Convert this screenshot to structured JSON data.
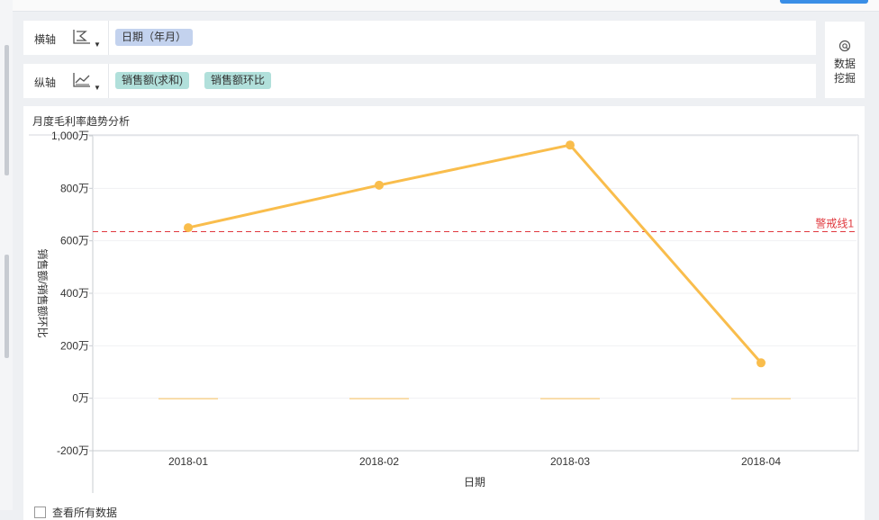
{
  "toolbar": {
    "x_axis_label": "横轴",
    "y_axis_label": "纵轴",
    "x_fields": [
      "日期（年月）"
    ],
    "y_fields": [
      "销售额(求和)",
      "销售额环比"
    ],
    "data_mining_label": "数据挖掘"
  },
  "panel": {
    "title": "月度毛利率趋势分析",
    "footer_text": "查看所有数据"
  },
  "colors": {
    "line": "#f9bd4c",
    "warning": "#e0383e",
    "pill_blue": "#c3d2ee",
    "pill_teal": "#b1e0db"
  },
  "chart_data": {
    "type": "line",
    "title": "月度毛利率趋势分析",
    "xlabel": "日期",
    "ylabel": "销售额/销售额环比",
    "categories": [
      "2018-01",
      "2018-02",
      "2018-03",
      "2018-04"
    ],
    "series": [
      {
        "name": "销售额(求和)",
        "type": "line",
        "values": [
          650,
          812,
          965,
          135
        ]
      },
      {
        "name": "销售额环比",
        "type": "bar",
        "values": [
          0,
          0.2,
          0.2,
          -0.9
        ]
      }
    ],
    "ylim": [
      -200,
      1000
    ],
    "yticks": [
      -200,
      0,
      200,
      400,
      600,
      800,
      1000
    ],
    "ytick_labels": [
      "-200万",
      "0万",
      "200万",
      "400万",
      "600万",
      "800万",
      "1,000万"
    ],
    "reference_lines": [
      {
        "label": "警戒线1",
        "value": 635
      }
    ],
    "grid": true,
    "legend": "none"
  }
}
